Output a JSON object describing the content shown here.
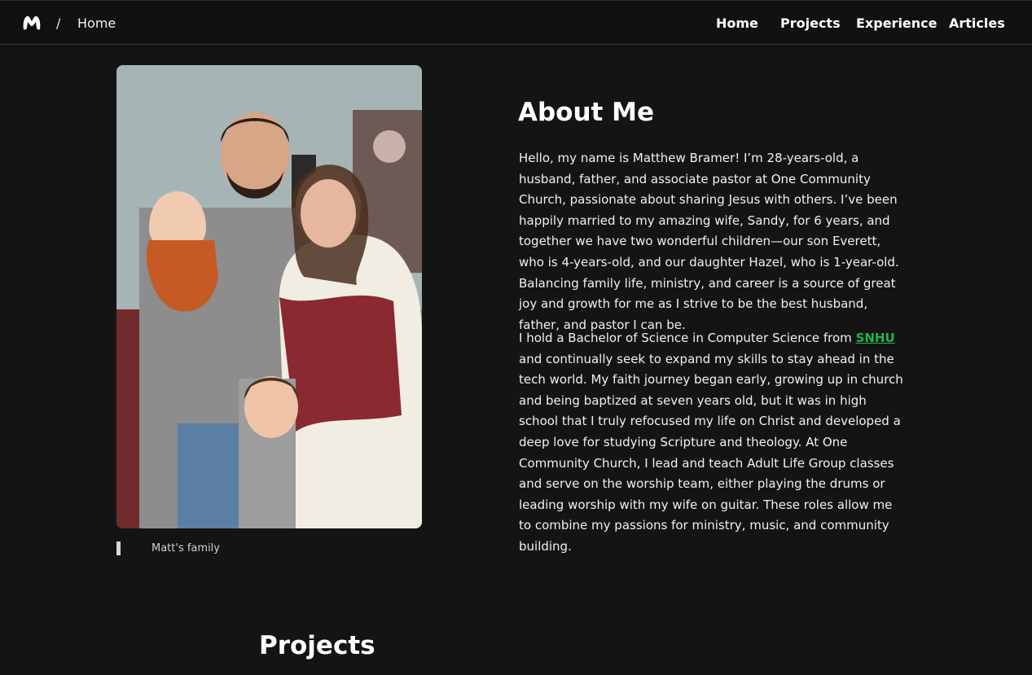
{
  "header": {
    "logo_icon": "m-logo-icon",
    "breadcrumb_separator": "/",
    "breadcrumb_current": "Home",
    "nav_items": [
      "Home",
      "Projects",
      "Experience",
      "Articles"
    ]
  },
  "photo": {
    "caption": "Matt's family"
  },
  "about": {
    "title": "About Me",
    "paragraph1": "Hello, my name is Matthew Bramer! I’m 28-years-old, a husband, father, and associate pastor at One Community Church, passionate about sharing Jesus with others. I’ve been happily married to my amazing wife, Sandy, for 6 years, and together we have two wonderful children—our son Everett, who is 4-years-old, and our daughter Hazel, who is 1-year-old. Balancing family life, ministry, and career is a source of great joy and growth for me as I strive to be the best husband, father, and pastor I can be.",
    "paragraph2_before": "I hold a Bachelor of Science in Computer Science from ",
    "paragraph2_link": "SNHU",
    "paragraph2_after": " and continually seek to expand my skills to stay ahead in the tech world. My faith journey began early, growing up in church and being baptized at seven years old, but it was in high school that I truly refocused my life on Christ and developed a deep love for studying Scripture and theology. At One Community Church, I lead and teach Adult Life Group classes and serve on the worship team, either playing the drums or leading worship with my wife on guitar. These roles allow me to combine my passions for ministry, music, and community building."
  },
  "projects": {
    "title": "Projects"
  },
  "colors": {
    "background": "#141414",
    "navbar": "#111111",
    "link_accent": "#22b34c"
  }
}
